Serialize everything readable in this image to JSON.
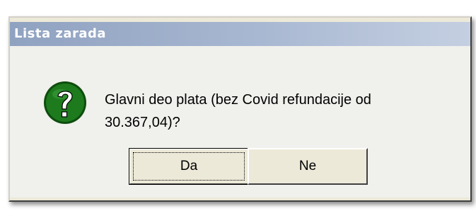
{
  "dialog": {
    "title": "Lista zarada",
    "message_line1": "Glavni deo plata (bez Covid refundacije od",
    "message_line2": "30.367,04)?",
    "icon": "question-icon",
    "buttons": {
      "yes_label": "Da",
      "no_label": "Ne"
    }
  },
  "colors": {
    "title_bar": "#a9b8d2",
    "dialog_bg": "#f0f0ec",
    "icon_green": "#1d7a1d"
  }
}
